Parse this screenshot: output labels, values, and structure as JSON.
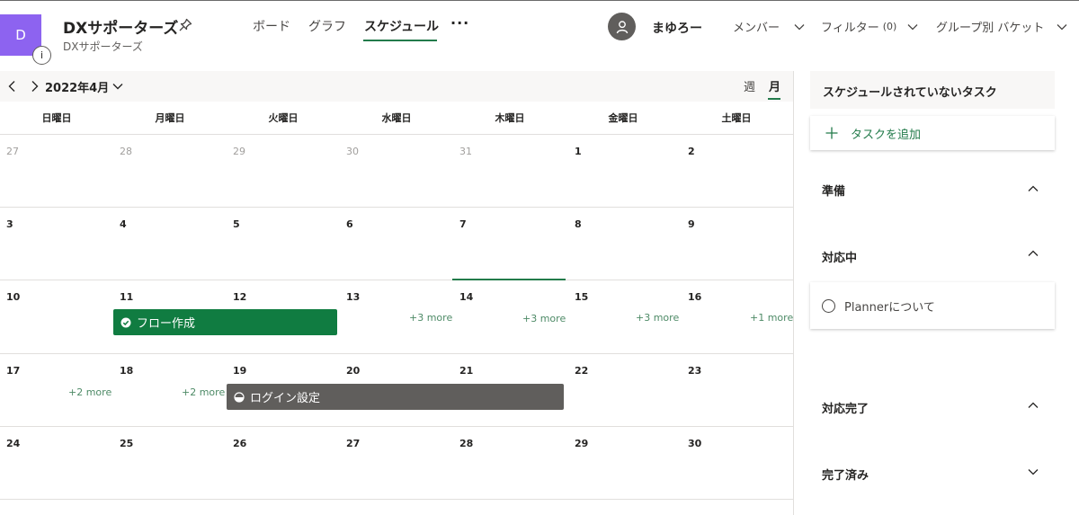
{
  "header": {
    "avatar_letter": "D",
    "info_glyph": "i",
    "plan_title": "DXサポーターズ",
    "plan_subtitle": "DXサポーターズ",
    "tabs": [
      "ボード",
      "グラフ",
      "スケジュール"
    ],
    "active_tab": "スケジュール",
    "more": "···",
    "user_name": "まゆろー",
    "members_label": "メンバー",
    "filter_label": "フィルター",
    "filter_count": "(0)",
    "group_label": "グループ別 バケット"
  },
  "calendar": {
    "month_label": "2022年4月",
    "view_week": "週",
    "view_month": "月",
    "weekdays": [
      "日曜日",
      "月曜日",
      "火曜日",
      "水曜日",
      "木曜日",
      "金曜日",
      "土曜日"
    ],
    "weeks": [
      [
        "27",
        "28",
        "29",
        "30",
        "31",
        "1",
        "2"
      ],
      [
        "3",
        "4",
        "5",
        "6",
        "7",
        "8",
        "9"
      ],
      [
        "10",
        "11",
        "12",
        "13",
        "14",
        "15",
        "16"
      ],
      [
        "17",
        "18",
        "19",
        "20",
        "21",
        "22",
        "23"
      ],
      [
        "24",
        "25",
        "26",
        "27",
        "28",
        "29",
        "30"
      ]
    ],
    "more_links": {
      "w3_wed": "+3 more",
      "w3_thu": "+3 more",
      "w3_fri": "+3 more",
      "w3_sat": "+1 more",
      "w4_sun": "+2 more",
      "w4_mon": "+2 more"
    },
    "tasks": {
      "flow": "フロー作成",
      "login": "ログイン設定"
    }
  },
  "unscheduled": {
    "title": "スケジュールされていないタスク",
    "add_task": "タスクを追加",
    "buckets": [
      "準備",
      "対応中",
      "対応完了",
      "完了済み"
    ],
    "task_card": "Plannerについて"
  },
  "colors": {
    "accent": "#237b4b",
    "task_green": "#107c41",
    "task_gray": "#605e5c",
    "avatar_purple": "#8d63f0"
  }
}
